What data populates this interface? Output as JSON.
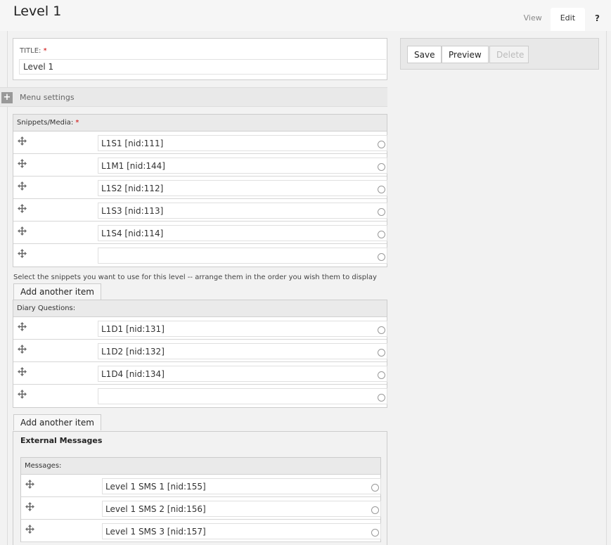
{
  "page": {
    "title": "Level 1"
  },
  "tabs": [
    {
      "label": "View"
    },
    {
      "label": "Edit"
    },
    {
      "label": "?"
    }
  ],
  "title_field": {
    "label": "TITLE:",
    "required_mark": "*",
    "value": "Level 1"
  },
  "menu_settings": {
    "toggle": "+",
    "label": "Menu settings"
  },
  "snippets": {
    "label": "Snippets/Media:",
    "required_mark": "*",
    "items": [
      "L1S1 [nid:111]",
      "L1M1 [nid:144]",
      "L1S2 [nid:112]",
      "L1S3 [nid:113]",
      "L1S4 [nid:114]",
      ""
    ],
    "description": "Select the snippets you want to use for this level -- arrange them in the order you wish them to display",
    "add_label": "Add another item"
  },
  "diary": {
    "label": "Diary Questions:",
    "items": [
      "L1D1 [nid:131]",
      "L1D2 [nid:132]",
      "L1D4 [nid:134]",
      ""
    ],
    "add_label": "Add another item"
  },
  "external": {
    "title": "External Messages",
    "messages_label": "Messages:",
    "items": [
      "Level 1 SMS 1 [nid:155]",
      "Level 1 SMS 2 [nid:156]",
      "Level 1 SMS 3 [nid:157]"
    ]
  },
  "actions": {
    "save": "Save",
    "preview": "Preview",
    "delete": "Delete"
  },
  "colors": {
    "required": "#cc0000",
    "background": "#f2f2f2",
    "header_bg": "#eaeaea"
  }
}
